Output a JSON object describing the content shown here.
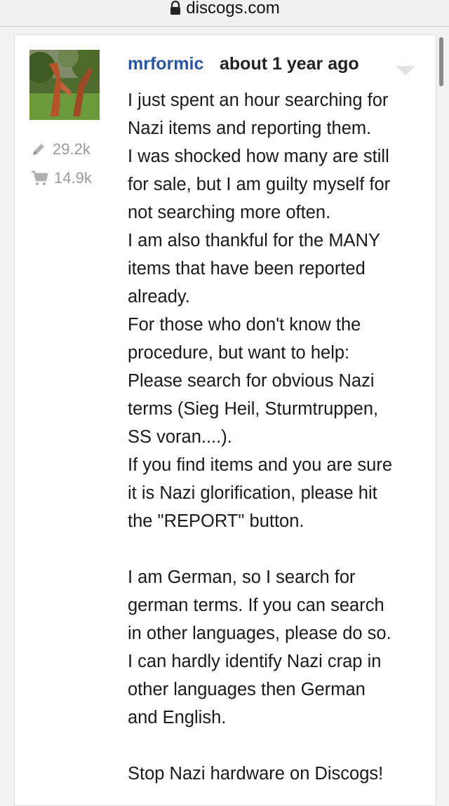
{
  "browser": {
    "url": "discogs.com",
    "lock_icon": "lock-icon"
  },
  "comment": {
    "username": "mrformic",
    "time_ago": "about 1 year ago",
    "dropdown_icon": "chevron-down-icon",
    "avatar": "user-avatar",
    "stats": {
      "edits_icon": "pencil-icon",
      "edits": "29.2k",
      "sales_icon": "cart-icon",
      "sales": "14.9k"
    },
    "lines": [
      "I just spent an hour searching for",
      "Nazi items and reporting them.",
      "I was shocked how many are still",
      "for sale, but I am guilty myself for",
      "not searching more often.",
      "I am also thankful for the MANY",
      "items that have been reported",
      "already.",
      "For those who don't know the",
      "procedure, but want to help:",
      "Please search for obvious Nazi",
      "terms (Sieg Heil, Sturmtruppen,",
      "SS voran....).",
      "If you find items and you are sure",
      "it is Nazi glorification, please hit",
      "the \"REPORT\" button.",
      "",
      "I am German, so I search for",
      "german terms. If you can search",
      "in other languages, please do so.",
      "I can hardly identify Nazi crap in",
      "other languages then German",
      "and English.",
      "",
      "Stop Nazi hardware on Discogs!"
    ]
  }
}
